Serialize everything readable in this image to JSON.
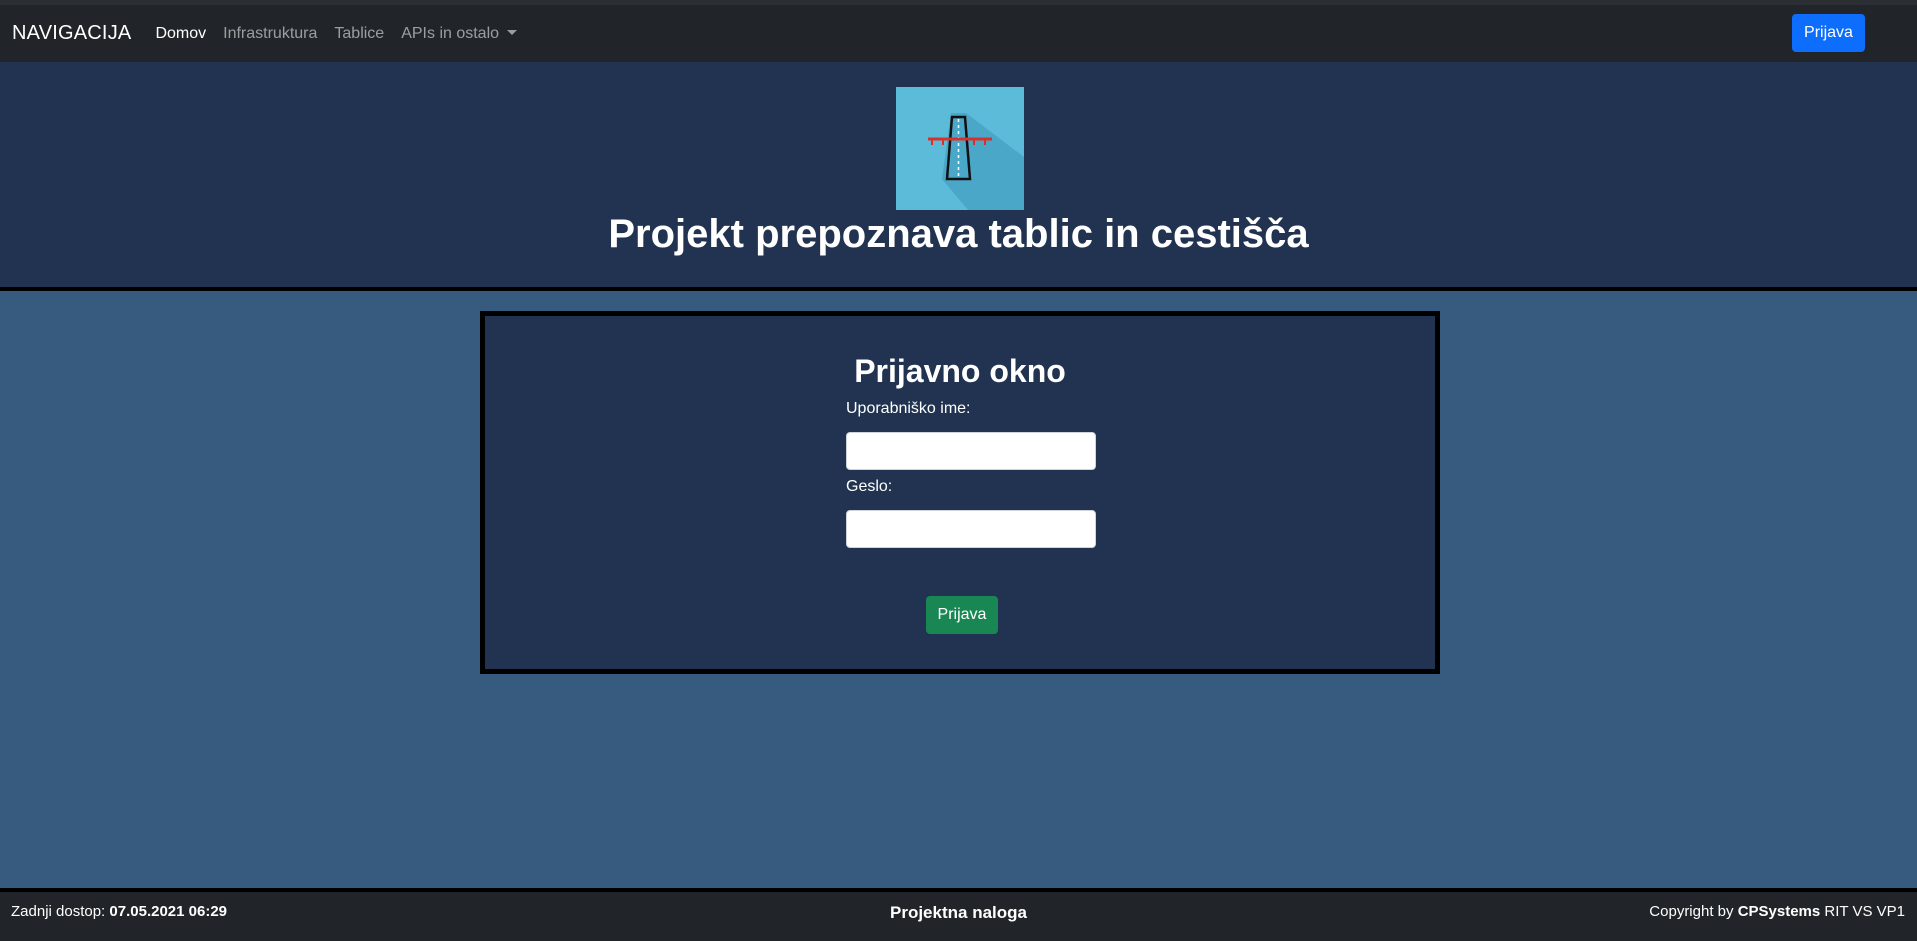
{
  "navbar": {
    "brand": "NAVIGACIJA",
    "links": [
      {
        "label": "Domov"
      },
      {
        "label": "Infrastruktura"
      },
      {
        "label": "Tablice"
      },
      {
        "label": "APIs in ostalo"
      }
    ],
    "login_button": "Prijava"
  },
  "header": {
    "logo_icon": "road-icon",
    "title": "Projekt prepoznava tablic in cestišča"
  },
  "login": {
    "title": "Prijavno okno",
    "username_label": "Uporabniško ime:",
    "username_value": "",
    "password_label": "Geslo:",
    "password_value": "",
    "submit_label": "Prijava"
  },
  "footer": {
    "last_access_label": "Zadnji dostop:",
    "last_access_value": "07.05.2021 06:29",
    "center": "Projektna naloga",
    "copyright_prefix": "Copyright by",
    "company": "CPSystems",
    "copyright_suffix": "RIT VS VP1"
  },
  "colors": {
    "page_bg": "#375a7f",
    "header_bg": "#213350",
    "navbar_bg": "#212529",
    "primary": "#0d6efd",
    "success": "#198754",
    "logo_bg": "#5bbbd9"
  }
}
